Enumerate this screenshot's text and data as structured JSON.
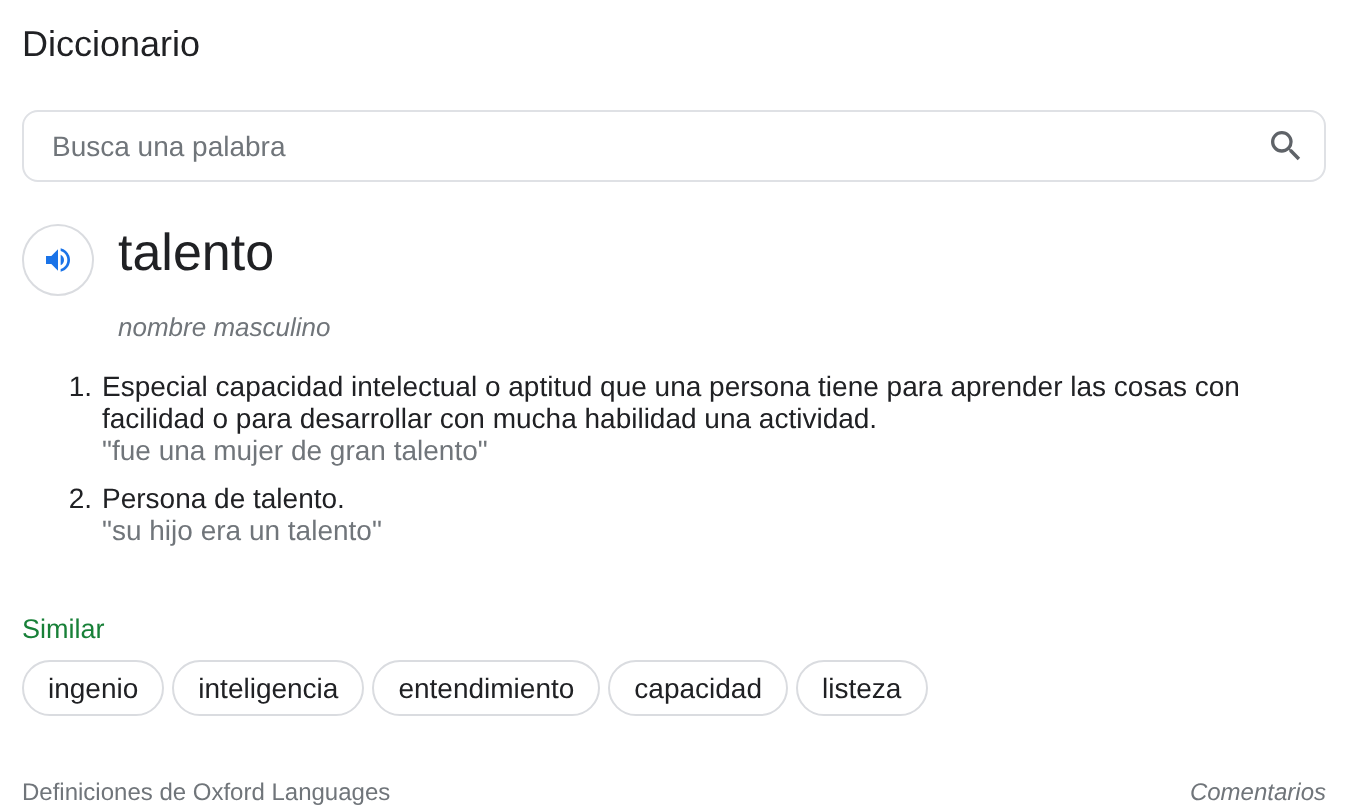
{
  "title": "Diccionario",
  "search": {
    "placeholder": "Busca una palabra"
  },
  "entry": {
    "word": "talento",
    "part_of_speech": "nombre masculino"
  },
  "definitions": [
    {
      "number": "1.",
      "text": "Especial capacidad intelectual o aptitud que una persona tiene para aprender las cosas con facilidad o para desarrollar con mucha habilidad una actividad.",
      "example": "\"fue una mujer de gran talento\""
    },
    {
      "number": "2.",
      "text": "Persona de talento.",
      "example": "\"su hijo era un talento\""
    }
  ],
  "similar": {
    "label": "Similar",
    "words": [
      "ingenio",
      "inteligencia",
      "entendimiento",
      "capacidad",
      "listeza"
    ]
  },
  "footer": {
    "source": "Definiciones de Oxford Languages",
    "feedback": "Comentarios"
  }
}
